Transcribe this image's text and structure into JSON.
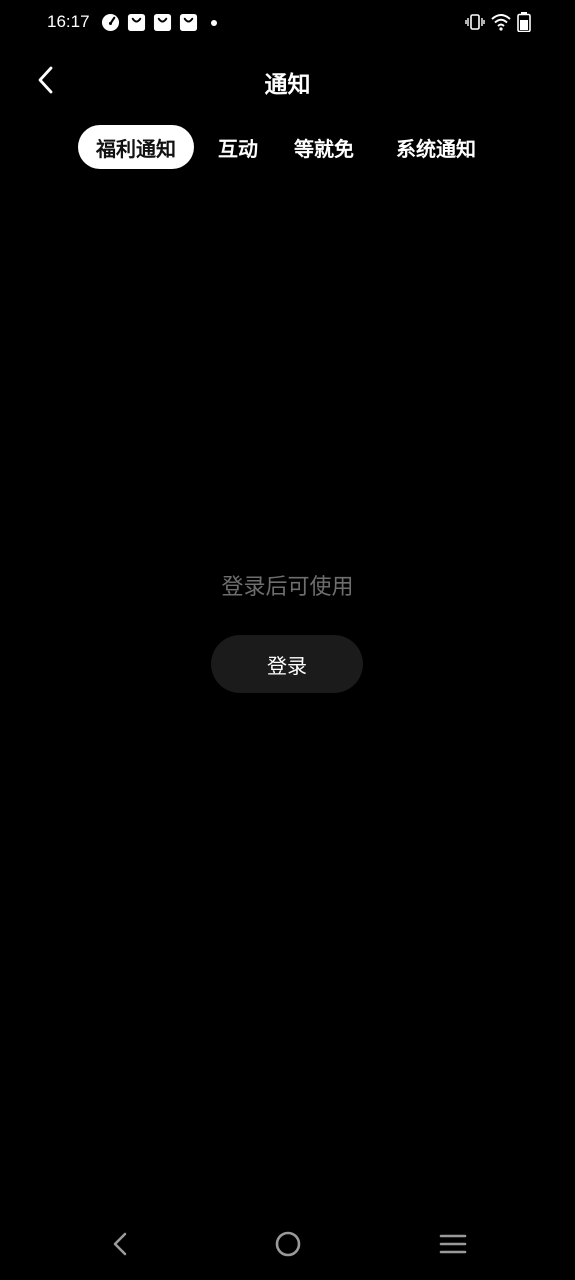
{
  "status_bar": {
    "time": "16:17",
    "left_icons": [
      "speedometer-icon",
      "shopping-bag-icon",
      "shopping-bag-icon",
      "shopping-bag-icon",
      "notification-dot-icon"
    ],
    "right_icons": [
      "vibrate-icon",
      "wifi-icon",
      "battery-icon"
    ]
  },
  "header": {
    "title": "通知",
    "back_icon": "chevron-left-icon"
  },
  "tabs": [
    {
      "label": "福利通知",
      "active": true
    },
    {
      "label": "互动",
      "active": false
    },
    {
      "label": "等就免",
      "active": false
    },
    {
      "label": "系统通知",
      "active": false
    }
  ],
  "empty_state": {
    "message": "登录后可使用",
    "button_label": "登录"
  },
  "nav_bar": {
    "icons": [
      "back-triangle-icon",
      "home-circle-icon",
      "menu-lines-icon"
    ]
  },
  "colors": {
    "background": "#000000",
    "text_primary": "#ffffff",
    "text_muted": "#6e6e6e",
    "tab_active_bg": "#ffffff",
    "tab_active_text": "#111111",
    "button_bg": "#1b1b1b"
  }
}
